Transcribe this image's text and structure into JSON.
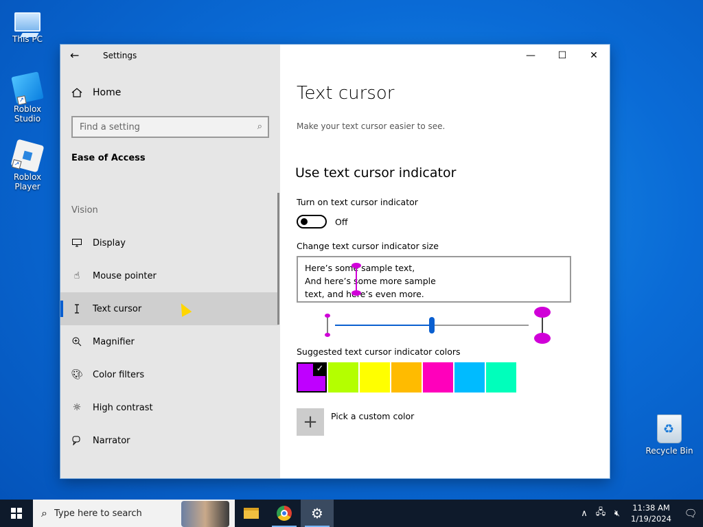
{
  "desktop": {
    "icons": [
      {
        "label": "This PC"
      },
      {
        "label": "Roblox Studio"
      },
      {
        "label": "Roblox Player"
      },
      {
        "label": "Recycle Bin"
      }
    ]
  },
  "window": {
    "app_title": "Settings",
    "home_label": "Home",
    "search_placeholder": "Find a setting",
    "section_title": "Ease of Access",
    "group_label": "Vision",
    "nav_items": [
      {
        "label": "Display",
        "icon": "monitor-icon"
      },
      {
        "label": "Mouse pointer",
        "icon": "mouse-pointer-icon"
      },
      {
        "label": "Text cursor",
        "icon": "text-cursor-icon",
        "active": true
      },
      {
        "label": "Magnifier",
        "icon": "magnifier-icon"
      },
      {
        "label": "Color filters",
        "icon": "palette-icon"
      },
      {
        "label": "High contrast",
        "icon": "sun-icon"
      },
      {
        "label": "Narrator",
        "icon": "narrator-icon"
      }
    ]
  },
  "main": {
    "title": "Text cursor",
    "description": "Make your text cursor easier to see.",
    "subtitle": "Use text cursor indicator",
    "toggle_label": "Turn on text cursor indicator",
    "toggle_state": "Off",
    "size_label": "Change text cursor indicator size",
    "preview_lines": [
      "Here’s some sample text,",
      "And here’s some more sample",
      "text, and here’s even more."
    ],
    "slider_value_fraction": 0.5,
    "colors_label": "Suggested text cursor indicator colors",
    "colors": [
      "#bf00ff",
      "#b4ff00",
      "#ffff00",
      "#ffbb00",
      "#ff00bb",
      "#00bbff",
      "#00ffbb"
    ],
    "selected_color_index": 0,
    "custom_color_label": "Pick a custom color"
  },
  "taskbar": {
    "search_placeholder": "Type here to search",
    "time": "11:38 AM",
    "date": "1/19/2024"
  }
}
